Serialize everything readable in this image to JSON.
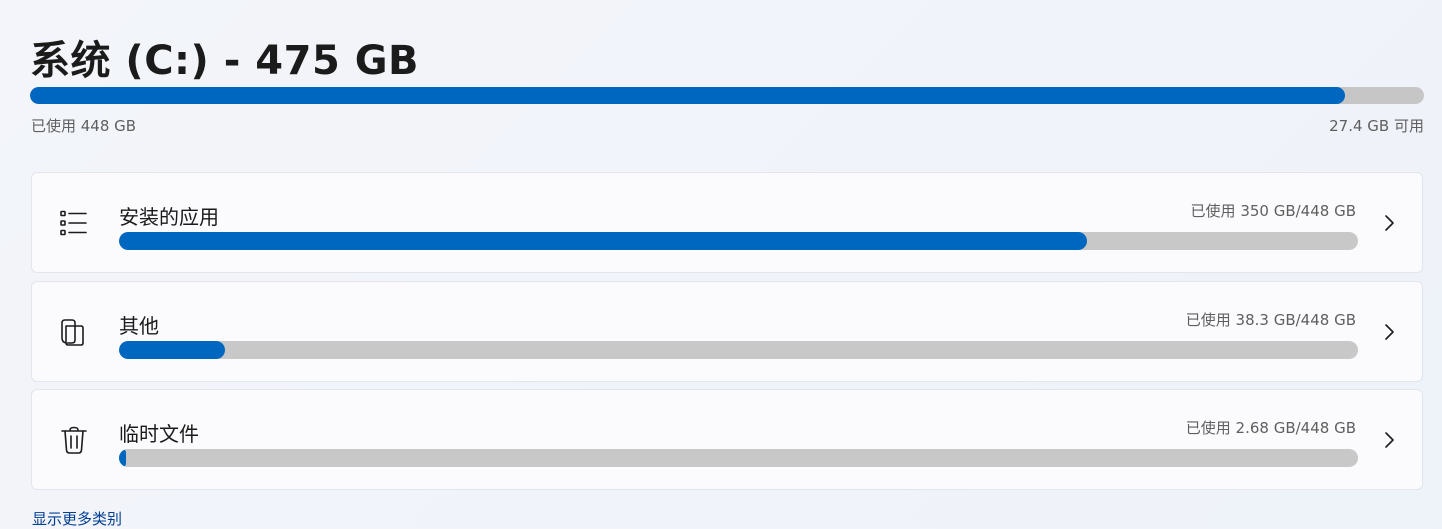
{
  "drive": {
    "title": "系统 (C:) - 475 GB",
    "used_label": "已使用 448 GB",
    "free_label": "27.4 GB 可用",
    "used_fraction": 0.943
  },
  "categories": [
    {
      "label": "安装的应用",
      "usage": "已使用 350 GB/448 GB",
      "fraction": 0.7813,
      "icon": "list-icon"
    },
    {
      "label": "其他",
      "usage": "已使用 38.3 GB/448 GB",
      "fraction": 0.0855,
      "icon": "folder-icon"
    },
    {
      "label": "临时文件",
      "usage": "已使用 2.68 GB/448 GB",
      "fraction": 0.006,
      "icon": "trash-icon"
    }
  ],
  "show_more": "显示更多类别",
  "colors": {
    "accent": "#0067c0",
    "track": "#c6c6c6",
    "link": "#003e92"
  }
}
